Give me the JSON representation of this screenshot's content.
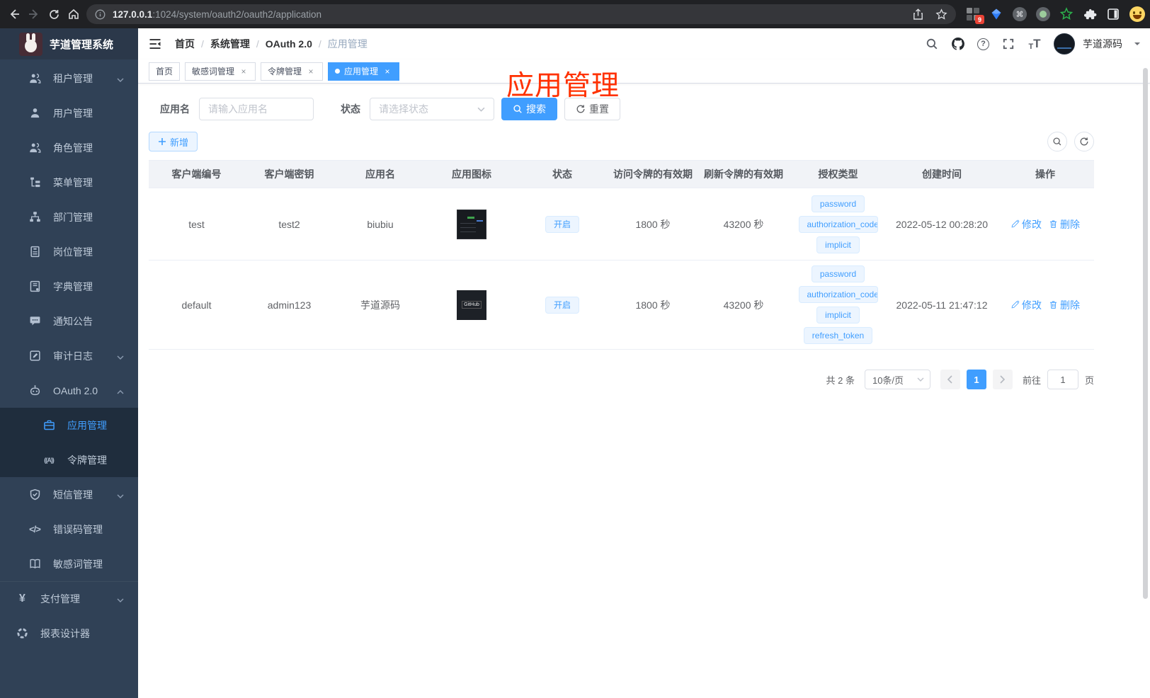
{
  "browser": {
    "url_prefix": "127.0.0.1",
    "url_suffix": ":1024/system/oauth2/oauth2/application",
    "extension_badge": "9"
  },
  "icons": {
    "help_glyph": "?",
    "close_glyph": "×",
    "font_small": "T",
    "font_big": "T",
    "yen": "¥",
    "code": "</>",
    "token": "((A))",
    "cmd": "⌘",
    "breadcrumb_sep": "/"
  },
  "sidebar": {
    "logo_title": "芋道管理系统",
    "items": [
      {
        "label": "租户管理"
      },
      {
        "label": "用户管理"
      },
      {
        "label": "角色管理"
      },
      {
        "label": "菜单管理"
      },
      {
        "label": "部门管理"
      },
      {
        "label": "岗位管理"
      },
      {
        "label": "字典管理"
      },
      {
        "label": "通知公告"
      },
      {
        "label": "审计日志"
      },
      {
        "label": "OAuth 2.0"
      },
      {
        "label": "应用管理"
      },
      {
        "label": "令牌管理"
      },
      {
        "label": "短信管理"
      },
      {
        "label": "错误码管理"
      },
      {
        "label": "敏感词管理"
      },
      {
        "label": "支付管理"
      },
      {
        "label": "报表设计器"
      }
    ]
  },
  "header": {
    "breadcrumb": [
      "首页",
      "系统管理",
      "OAuth 2.0",
      "应用管理"
    ],
    "username": "芋道源码"
  },
  "tabs": [
    {
      "label": "首页"
    },
    {
      "label": "敏感词管理"
    },
    {
      "label": "令牌管理"
    },
    {
      "label": "应用管理"
    }
  ],
  "annotation": "应用管理",
  "filters": {
    "name_label": "应用名",
    "name_placeholder": "请输入应用名",
    "status_label": "状态",
    "status_placeholder": "请选择状态",
    "search_label": "搜索",
    "reset_label": "重置"
  },
  "toolbar": {
    "add_label": "新增"
  },
  "table": {
    "columns": [
      "客户端编号",
      "客户端密钥",
      "应用名",
      "应用图标",
      "状态",
      "访问令牌的有效期",
      "刷新令牌的有效期",
      "授权类型",
      "创建时间",
      "操作"
    ],
    "rows": [
      {
        "client_id": "test",
        "secret": "test2",
        "name": "biubiu",
        "status": "开启",
        "access_ttl": "1800 秒",
        "refresh_ttl": "43200 秒",
        "grants": [
          "password",
          "authorization_code",
          "implicit"
        ],
        "created": "2022-05-12 00:28:20",
        "edit": "修改",
        "delete": "删除"
      },
      {
        "client_id": "default",
        "secret": "admin123",
        "name": "芋道源码",
        "icon_text": "GitHub",
        "status": "开启",
        "access_ttl": "1800 秒",
        "refresh_ttl": "43200 秒",
        "grants": [
          "password",
          "authorization_code",
          "implicit",
          "refresh_token"
        ],
        "created": "2022-05-11 21:47:12",
        "edit": "修改",
        "delete": "删除"
      }
    ]
  },
  "pagination": {
    "total": "共 2 条",
    "page_size": "10条/页",
    "current_page": "1",
    "goto_label": "前往",
    "goto_value": "1",
    "page_suffix": "页"
  }
}
